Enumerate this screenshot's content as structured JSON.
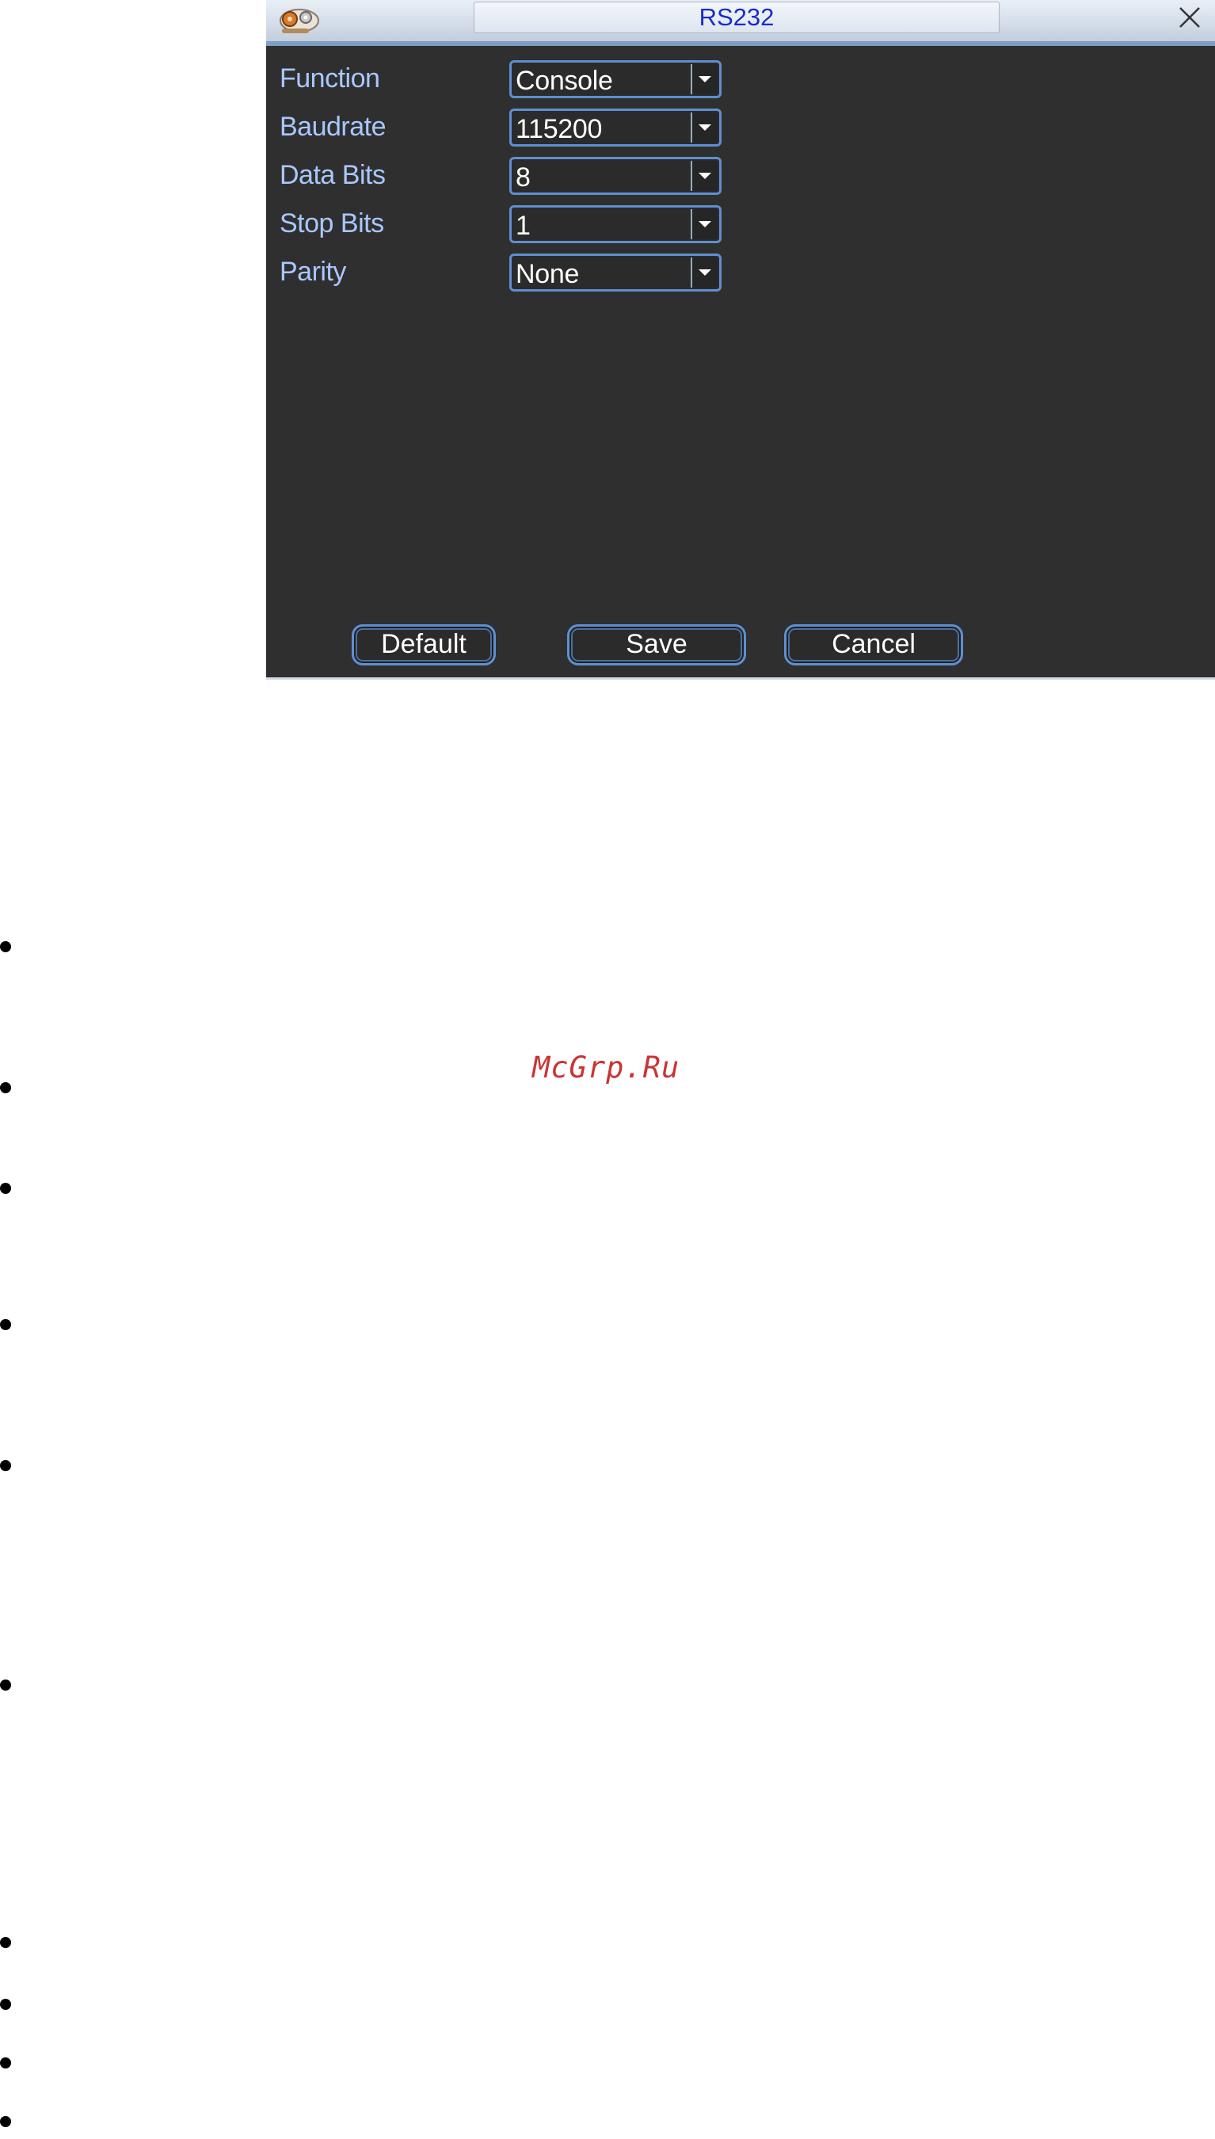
{
  "window": {
    "title": "RS232",
    "icon": "settings-gear-icon",
    "close_icon": "close-icon"
  },
  "fields": [
    {
      "label": "Function",
      "value": "Console"
    },
    {
      "label": "Baudrate",
      "value": "115200"
    },
    {
      "label": "Data Bits",
      "value": "8"
    },
    {
      "label": "Stop Bits",
      "value": "1"
    },
    {
      "label": "Parity",
      "value": "None"
    }
  ],
  "buttons": {
    "default": "Default",
    "save": "Save",
    "cancel": "Cancel"
  },
  "watermark": "McGrp.Ru",
  "colors": {
    "dialog_bg": "#2f2f2f",
    "label": "#a9c7ff",
    "accent_border": "#5f8fd0",
    "title_text": "#1a2bc8",
    "watermark": "#cc3333"
  }
}
